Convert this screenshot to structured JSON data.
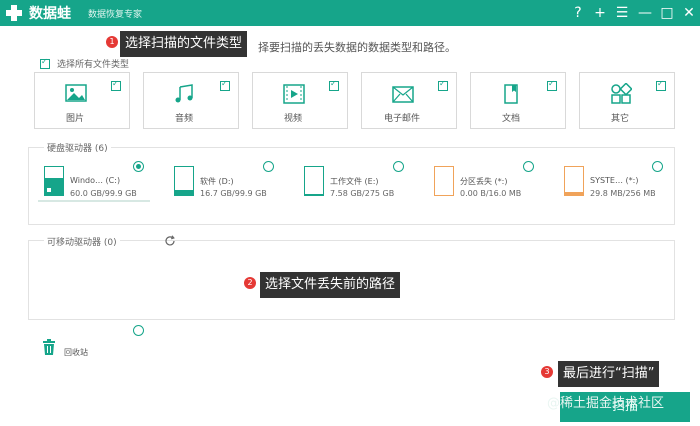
{
  "app": {
    "name": "数据蛙",
    "subtitle": "数据恢复专家",
    "window_controls": [
      "?",
      "+",
      "☰",
      "—",
      "□",
      "✕"
    ]
  },
  "callouts": {
    "step1": {
      "num": "1",
      "text": "选择扫描的文件类型"
    },
    "step2": {
      "num": "2",
      "text": "选择文件丢失前的路径"
    },
    "step3": {
      "num": "3",
      "text": "最后进行“扫描”"
    }
  },
  "instruction": "择要扫描的丢失数据的数据类型和路径。",
  "select_all": {
    "label": "选择所有文件类型",
    "checked": true
  },
  "file_types": [
    {
      "label": "图片",
      "icon": "image-icon",
      "checked": true
    },
    {
      "label": "音频",
      "icon": "music-icon",
      "checked": true
    },
    {
      "label": "视频",
      "icon": "video-icon",
      "checked": true
    },
    {
      "label": "电子邮件",
      "icon": "mail-icon",
      "checked": true
    },
    {
      "label": "文档",
      "icon": "document-icon",
      "checked": true
    },
    {
      "label": "其它",
      "icon": "other-icon",
      "checked": true
    }
  ],
  "hard_drives": {
    "title": "硬盘驱动器 (6)",
    "drives": [
      {
        "name": "Windo… (C:)",
        "size": "60.0 GB/99.9 GB",
        "selected": true,
        "color": "#16a58a"
      },
      {
        "name": "软件 (D:)",
        "size": "16.7 GB/99.9 GB",
        "selected": false,
        "color": "#16a58a"
      },
      {
        "name": "工作文件 (E:)",
        "size": "7.58 GB/275 GB",
        "selected": false,
        "color": "#16a58a"
      },
      {
        "name": "分区丢失 (*:)",
        "size": "0.00  B/16.0 MB",
        "selected": false,
        "color": "#f0a35a"
      },
      {
        "name": "SYSTE… (*:)",
        "size": "29.8 MB/256 MB",
        "selected": false,
        "color": "#f0a35a"
      }
    ]
  },
  "removable": {
    "title": "可移动驱动器 (0)"
  },
  "recycle_bin": {
    "label": "回收站"
  },
  "scan_button": {
    "label": "扫描"
  },
  "watermark": "@稀土掘金技术社区",
  "colors": {
    "brand": "#16a58a",
    "callout_bg": "#333333",
    "step_badge": "#e53935"
  }
}
